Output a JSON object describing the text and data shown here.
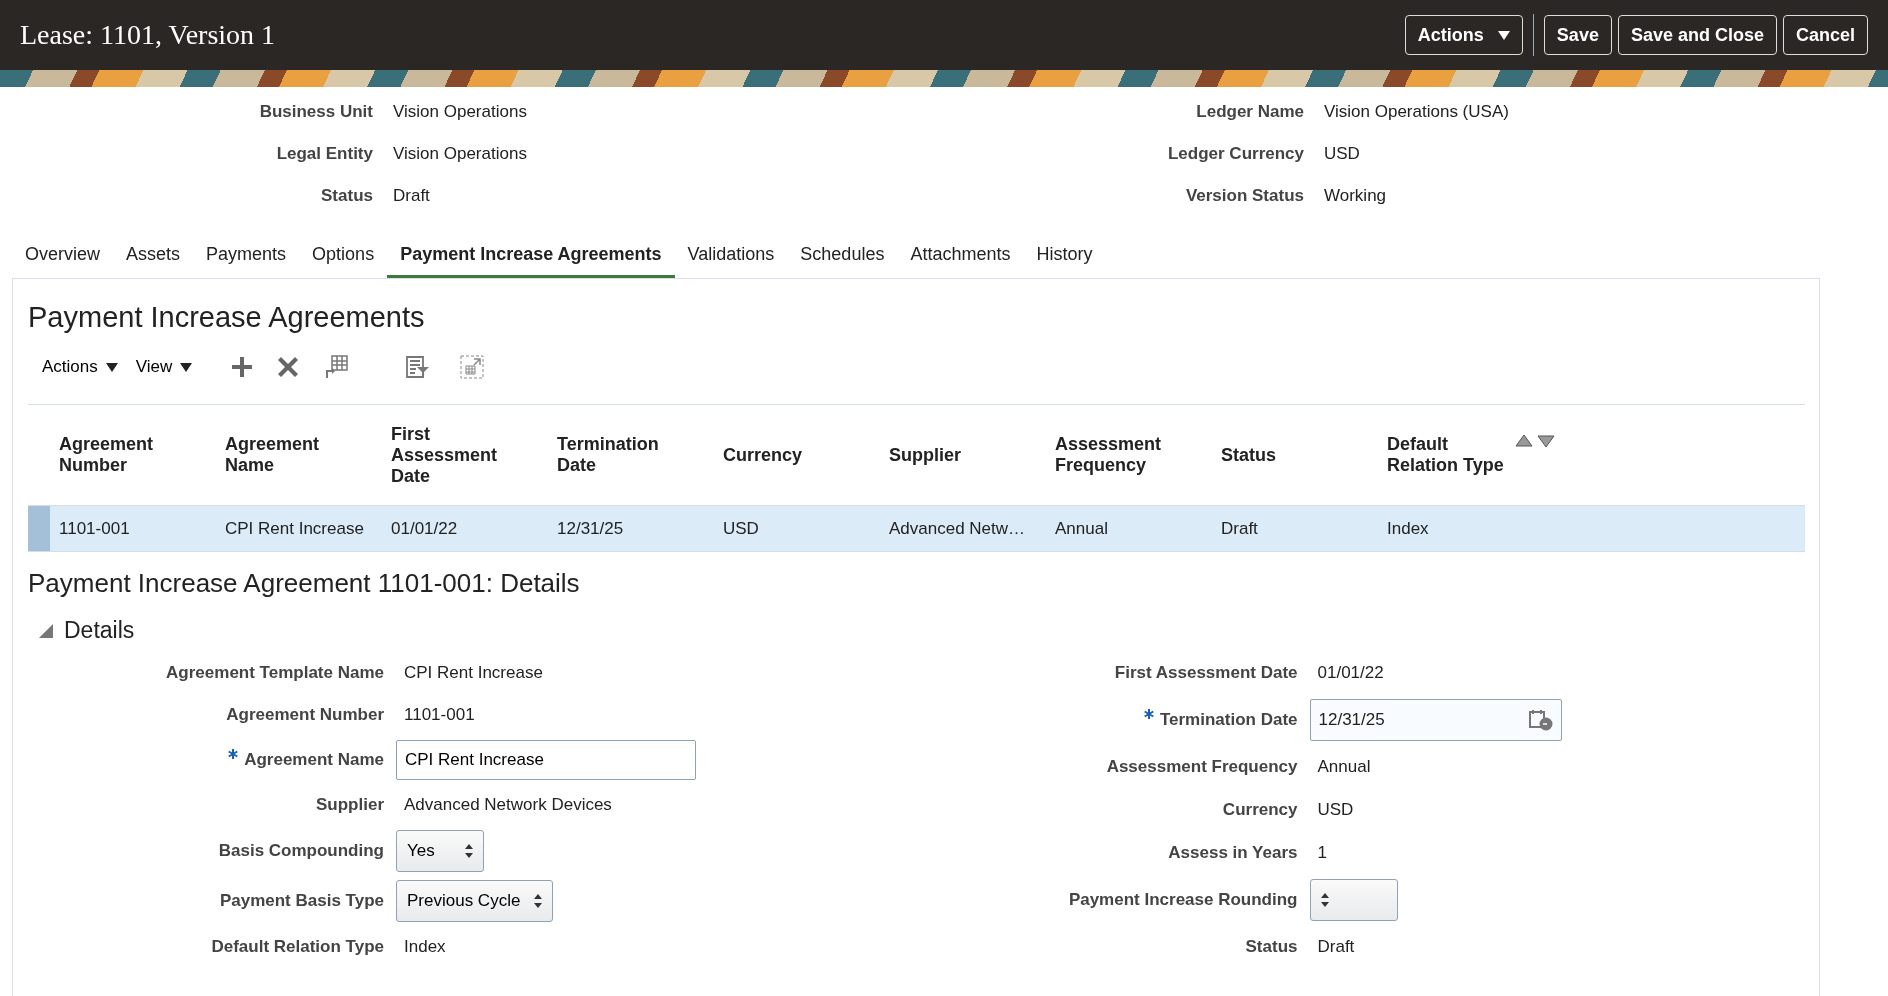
{
  "header": {
    "title": "Lease: 1101, Version 1",
    "actions_menu": "Actions",
    "buttons": [
      "Save",
      "Save and Close",
      "Cancel"
    ]
  },
  "summary": {
    "left": [
      {
        "label": "Business Unit",
        "value": "Vision Operations"
      },
      {
        "label": "Legal Entity",
        "value": "Vision Operations"
      },
      {
        "label": "Status",
        "value": "Draft"
      }
    ],
    "right": [
      {
        "label": "Ledger Name",
        "value": "Vision Operations (USA)"
      },
      {
        "label": "Ledger Currency",
        "value": "USD"
      },
      {
        "label": "Version Status",
        "value": "Working"
      }
    ]
  },
  "tabs": [
    {
      "label": "Overview",
      "selected": false
    },
    {
      "label": "Assets",
      "selected": false
    },
    {
      "label": "Payments",
      "selected": false
    },
    {
      "label": "Options",
      "selected": false
    },
    {
      "label": "Payment Increase Agreements",
      "selected": true
    },
    {
      "label": "Validations",
      "selected": false
    },
    {
      "label": "Schedules",
      "selected": false
    },
    {
      "label": "Attachments",
      "selected": false
    },
    {
      "label": "History",
      "selected": false
    }
  ],
  "panel_title": "Payment Increase Agreements",
  "toolbar": {
    "menus": [
      "Actions",
      "View"
    ]
  },
  "table": {
    "columns": [
      "Agreement Number",
      "Agreement Name",
      "First Assessment Date",
      "Termination Date",
      "Currency",
      "Supplier",
      "Assessment Frequency",
      "Status",
      "Default Relation Type"
    ],
    "rows": [
      {
        "selected": true,
        "cells": [
          "1101-001",
          "CPI Rent Increase",
          "01/01/22",
          "12/31/25",
          "USD",
          "Advanced Netw…",
          "Annual",
          "Draft",
          "Index"
        ]
      }
    ]
  },
  "details_title": "Payment Increase Agreement 1101-001: Details",
  "section": {
    "title": "Details",
    "expanded": true
  },
  "form": {
    "left": [
      {
        "kind": "text",
        "label": "Agreement Template Name",
        "value": "CPI Rent Increase",
        "required": false
      },
      {
        "kind": "text",
        "label": "Agreement Number",
        "value": "1101-001",
        "required": false
      },
      {
        "kind": "input",
        "label": "Agreement Name",
        "value": "CPI Rent Increase",
        "required": true
      },
      {
        "kind": "text",
        "label": "Supplier",
        "value": "Advanced Network Devices",
        "required": false
      },
      {
        "kind": "select",
        "label": "Basis Compounding",
        "value": "Yes",
        "required": false
      },
      {
        "kind": "select",
        "label": "Payment Basis Type",
        "value": "Previous Cycle",
        "required": false
      },
      {
        "kind": "text",
        "label": "Default Relation Type",
        "value": "Index",
        "required": false
      }
    ],
    "right": [
      {
        "kind": "text",
        "label": "First Assessment Date",
        "value": "01/01/22",
        "required": false
      },
      {
        "kind": "date",
        "label": "Termination Date",
        "value": "12/31/25",
        "required": true
      },
      {
        "kind": "text",
        "label": "Assessment Frequency",
        "value": "Annual",
        "required": false
      },
      {
        "kind": "text",
        "label": "Currency",
        "value": "USD",
        "required": false
      },
      {
        "kind": "text",
        "label": "Assess in Years",
        "value": "1",
        "required": false
      },
      {
        "kind": "select",
        "label": "Payment Increase Rounding",
        "required": false
      },
      {
        "kind": "text",
        "label": "Status",
        "value": "Draft",
        "required": false
      }
    ]
  }
}
